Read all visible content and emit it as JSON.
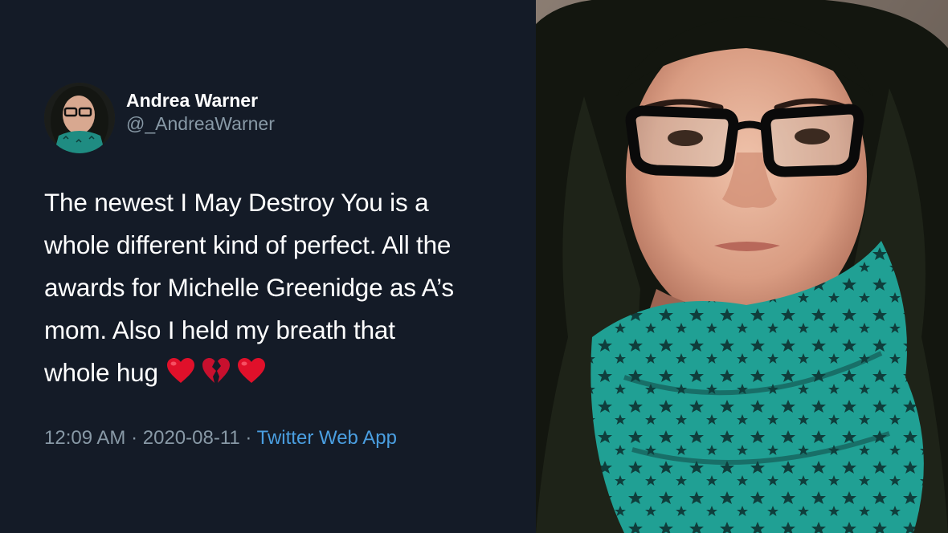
{
  "tweet": {
    "author": {
      "display_name": "Andrea Warner",
      "handle": "@_AndreaWarner"
    },
    "text_lines": [
      "The newest I May Destroy You is a",
      "whole different kind of perfect. All the",
      "awards for Michelle Greenidge as A’s",
      "mom. Also I held my breath that",
      "whole hug"
    ],
    "emojis": [
      "red-heart-icon",
      "broken-heart-icon",
      "red-heart-icon"
    ],
    "meta": {
      "time": "12:09 AM",
      "separator": "·",
      "date": "2020-08-11",
      "source": "Twitter Web App"
    }
  },
  "colors": {
    "background": "#141b27",
    "text": "#ffffff",
    "secondary": "#8899a6",
    "link": "#4a9ee0",
    "heart": "#e0102a",
    "scarf": "#1f9e93"
  }
}
